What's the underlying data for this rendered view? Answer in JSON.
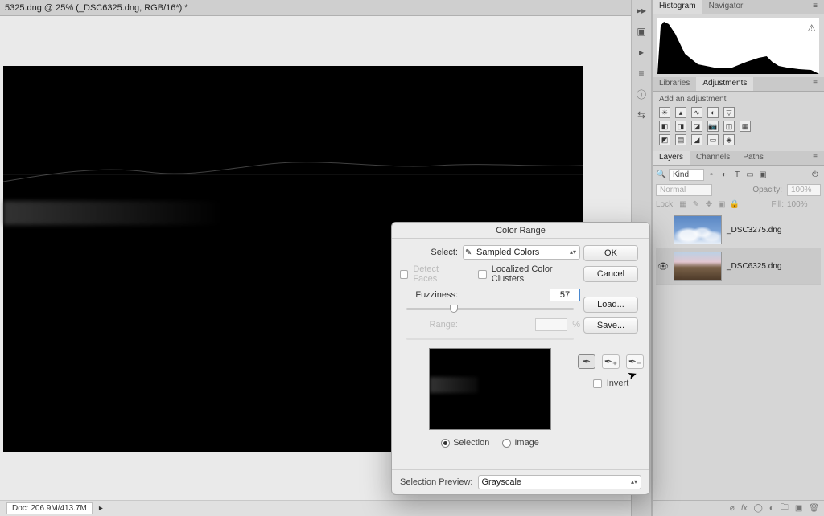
{
  "document": {
    "tab_title": "5325.dng @ 25% (_DSC6325.dng, RGB/16*) *"
  },
  "status": {
    "doc_size": "Doc: 206.9M/413.7M",
    "chevron": "▸"
  },
  "panels": {
    "histogram_tab": "Histogram",
    "navigator_tab": "Navigator",
    "libraries_tab": "Libraries",
    "adjustments_tab": "Adjustments",
    "layers_tab": "Layers",
    "channels_tab": "Channels",
    "paths_tab": "Paths"
  },
  "adjustments": {
    "hint": "Add an adjustment"
  },
  "layers": {
    "filter_kind": "Kind",
    "blend_mode": "Normal",
    "opacity_label": "Opacity:",
    "opacity_value": "100%",
    "lock_label": "Lock:",
    "fill_label": "Fill:",
    "fill_value": "100%",
    "items": [
      {
        "name": "_DSC3275.dng",
        "visible": false,
        "thumb": "sky"
      },
      {
        "name": "_DSC6325.dng",
        "visible": true,
        "thumb": "land"
      }
    ]
  },
  "dialog": {
    "title": "Color Range",
    "select_label": "Select:",
    "select_value": "Sampled Colors",
    "detect_faces": "Detect Faces",
    "localized": "Localized Color Clusters",
    "fuzziness_label": "Fuzziness:",
    "fuzziness_value": "57",
    "range_label": "Range:",
    "range_unit": "%",
    "radio_selection": "Selection",
    "radio_image": "Image",
    "preview_label": "Selection Preview:",
    "preview_value": "Grayscale",
    "invert_label": "Invert",
    "buttons": {
      "ok": "OK",
      "cancel": "Cancel",
      "load": "Load...",
      "save": "Save..."
    }
  }
}
